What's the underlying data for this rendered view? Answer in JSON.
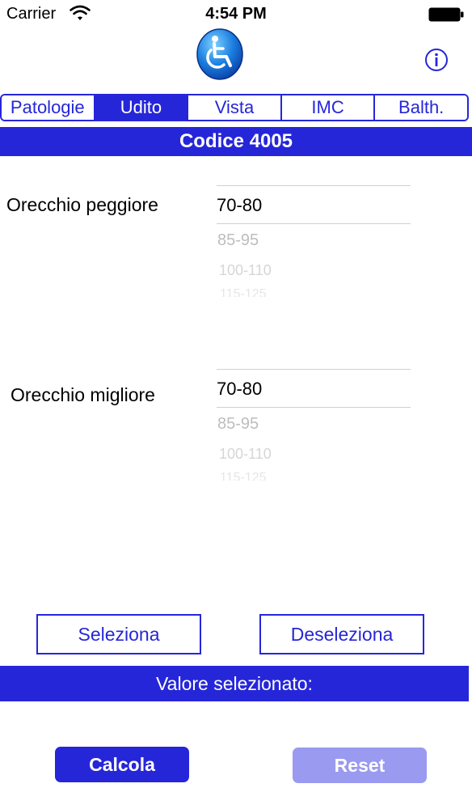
{
  "status_bar": {
    "carrier": "Carrier",
    "time": "4:54 PM"
  },
  "header": {
    "logo_icon": "wheelchair-logo-icon",
    "info_icon": "info-icon"
  },
  "tabs": [
    {
      "label": "Patologie",
      "active": false
    },
    {
      "label": "Udito",
      "active": true
    },
    {
      "label": "Vista",
      "active": false
    },
    {
      "label": "IMC",
      "active": false
    },
    {
      "label": "Balth.",
      "active": false
    }
  ],
  "title": "Codice 4005",
  "fields": [
    {
      "label": "Orecchio peggiore",
      "selected": "70-80",
      "options": [
        "85-95",
        "100-110",
        "115-125"
      ]
    },
    {
      "label": "Orecchio migliore",
      "selected": "70-80",
      "options": [
        "85-95",
        "100-110",
        "115-125"
      ]
    }
  ],
  "buttons": {
    "select": "Seleziona",
    "deselect": "Deseleziona",
    "calculate": "Calcola",
    "reset": "Reset"
  },
  "result_label": "Valore selezionato:",
  "colors": {
    "accent": "#2626d9",
    "reset_disabled": "#9a9af0"
  }
}
